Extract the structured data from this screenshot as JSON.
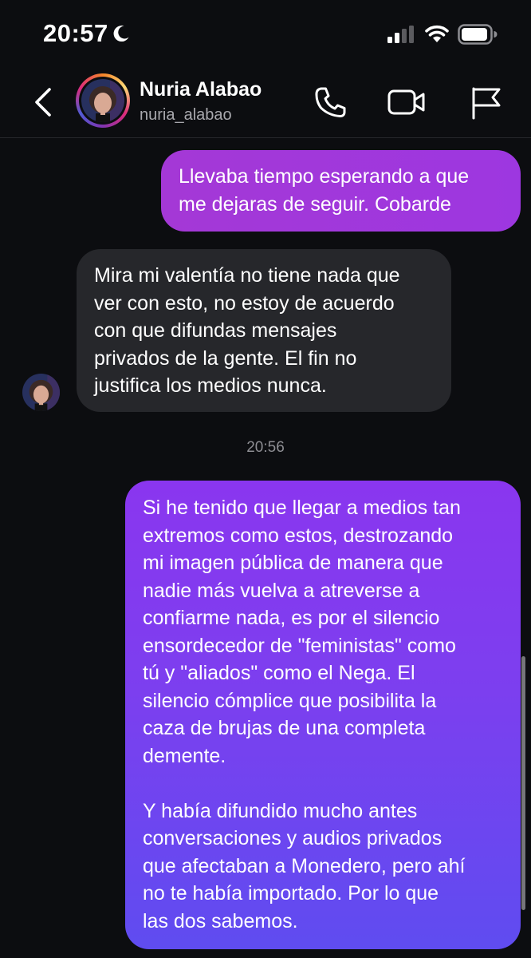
{
  "status_bar": {
    "time": "20:57",
    "icons": [
      "moon-icon",
      "signal-icon",
      "wifi-icon",
      "battery-icon"
    ]
  },
  "header": {
    "name": "Nuria Alabao",
    "username": "nuria_alabao",
    "icons": [
      "chevron-left-icon",
      "phone-icon",
      "video-camera-icon",
      "flag-icon"
    ]
  },
  "colors": {
    "background": "#0c0d10",
    "incoming_bubble": "#26272b",
    "outgoing_top": "#a438d6",
    "outgoing_bottom": "#5f4cf0",
    "muted_text": "#8e8e93"
  },
  "messages": [
    {
      "sender": "me",
      "text": "Llevaba tiempo esperando a que\nme dejaras de seguir. Cobarde"
    },
    {
      "sender": "them",
      "text": "Mira mi valentía no tiene nada que\nver con esto, no estoy de acuerdo\ncon que difundas mensajes\nprivados de la gente. El fin no\njustifica los medios nunca."
    },
    {
      "sender": "me",
      "text": "Si he tenido que llegar a medios tan\nextremos como estos, destrozando\nmi imagen pública de manera que\nnadie más vuelva a atreverse a\nconfiarme nada, es por el silencio\nensordecedor de \"feministas\" como\ntú y \"aliados\" como el Nega. El\nsilencio cómplice que posibilita la\ncaza de brujas de una completa\ndemente.\n\nY había difundido mucho antes\nconversaciones y audios privados\nque afectaban a Monedero, pero ahí\nno te había importado. Por lo que\nlas dos sabemos."
    }
  ],
  "timestamp": "20:56"
}
